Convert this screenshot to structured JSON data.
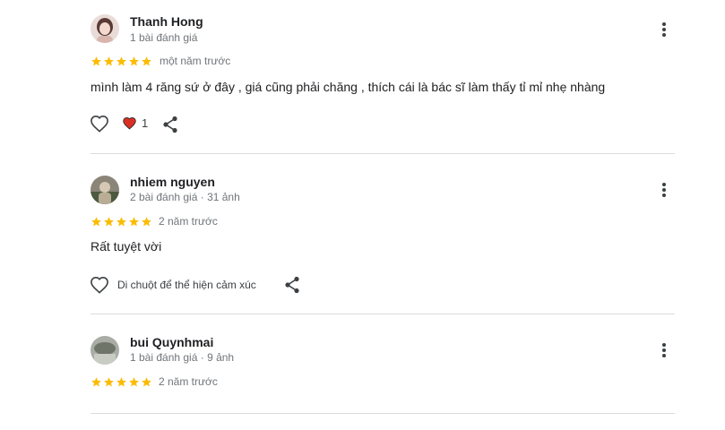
{
  "colors": {
    "star": "#fbbc04",
    "heart_filled": "#d93025",
    "text_secondary": "#70757a",
    "divider": "#dadce0"
  },
  "reviews": [
    {
      "author": "Thanh Hong",
      "meta": "1 bài đánh giá",
      "rating": 5,
      "time": "một năm trước",
      "text": "mình làm 4 răng sứ ở đây , giá cũng phải chăng , thích cái là bác sĩ làm thấy tỉ mỉ nhẹ nhàng",
      "like_count": "1",
      "icons": [
        "heart-outline-icon",
        "heart-filled-icon",
        "share-icon",
        "more-vert-icon"
      ]
    },
    {
      "author": "nhiem nguyen",
      "meta": "2 bài đánh giá · 31 ảnh",
      "rating": 5,
      "time": "2 năm trước",
      "text": "Rất tuyệt vời",
      "reaction_hint": "Di chuột để thể hiện cảm xúc",
      "icons": [
        "heart-outline-icon",
        "share-icon",
        "more-vert-icon"
      ]
    },
    {
      "author": "bui Quynhmai",
      "meta": "1 bài đánh giá · 9 ảnh",
      "rating": 5,
      "time": "2 năm trước",
      "icons": [
        "more-vert-icon"
      ]
    }
  ]
}
